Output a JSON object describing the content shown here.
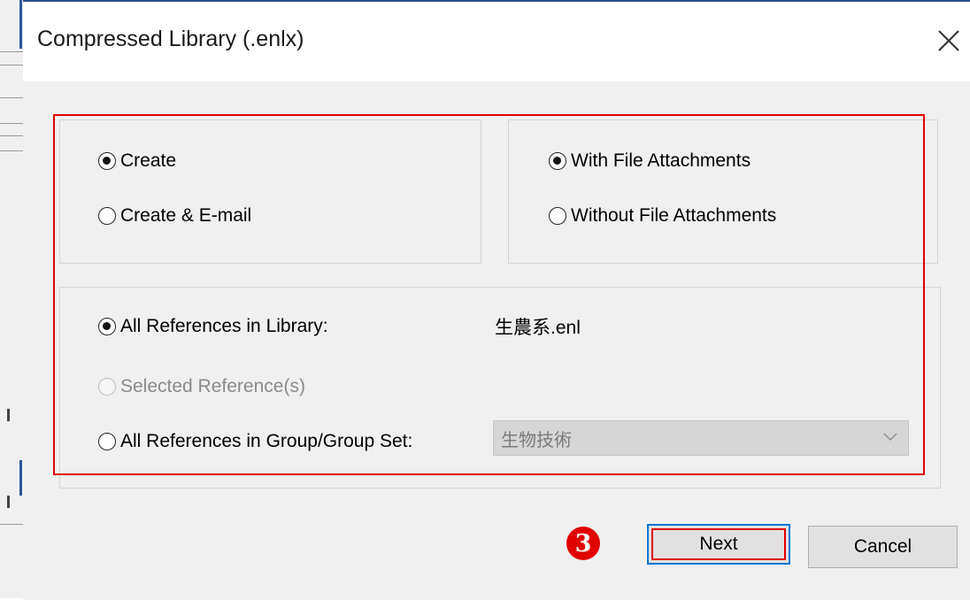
{
  "dialog": {
    "title": "Compressed Library (.enlx)"
  },
  "create_group": {
    "options": [
      {
        "label": "Create",
        "checked": true
      },
      {
        "label": "Create & E-mail",
        "checked": false
      }
    ]
  },
  "attachments_group": {
    "options": [
      {
        "label": "With File Attachments",
        "checked": true
      },
      {
        "label": "Without File Attachments",
        "checked": false
      }
    ]
  },
  "references_group": {
    "all_in_library": {
      "label": "All References in Library:",
      "checked": true
    },
    "library_name": "生農系.enl",
    "selected": {
      "label": "Selected Reference(s)",
      "checked": false,
      "disabled": true
    },
    "group_set": {
      "label": "All References in Group/Group Set:",
      "checked": false
    },
    "group_combo_value": "生物技術"
  },
  "buttons": {
    "next": "Next",
    "cancel": "Cancel"
  },
  "annotation": {
    "step_number": "3"
  },
  "colors": {
    "highlight": "#e00000",
    "focus_border": "#0078d7",
    "dialog_bg": "#f0f0f0"
  }
}
